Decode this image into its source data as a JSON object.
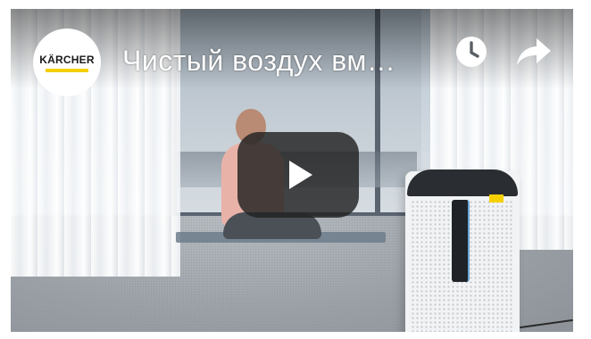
{
  "video": {
    "title": "Чистый воздух вм…",
    "channel_logo_text": "KÄRCHER",
    "brand_color": "#F5D000"
  },
  "controls": {
    "watch_later_icon": "clock-icon",
    "share_icon": "share-arrow-icon",
    "play_icon": "play-icon",
    "play_button_color": "#212121"
  }
}
